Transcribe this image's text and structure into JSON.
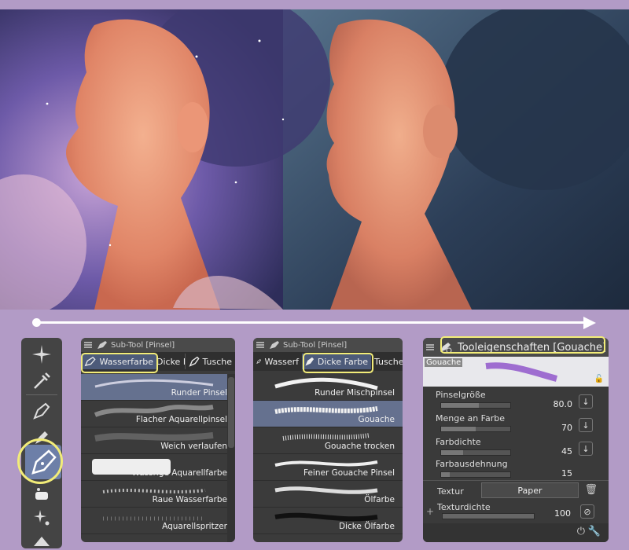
{
  "panel1": {
    "title": "Sub-Tool [Pinsel]",
    "tabs": [
      "Wasserfarbe",
      "Dicke F",
      "Tusche"
    ],
    "brushes": [
      "Runder Pinsel",
      "Flacher Aquarellpinsel",
      "Weich verlaufen",
      "Wässrige Aquarellfarbe",
      "Raue Wasserfarbe",
      "Aquarellspritzer"
    ],
    "selected": "Runder Pinsel"
  },
  "panel2": {
    "title": "Sub-Tool [Pinsel]",
    "tabs": [
      "Wasserf",
      "Dicke Farbe",
      "Tusche"
    ],
    "brushes": [
      "Runder Mischpinsel",
      "Gouache",
      "Gouache trocken",
      "Feiner Gouache Pinsel",
      "Ölfarbe",
      "Dicke Ölfarbe"
    ],
    "selected": "Gouache"
  },
  "props": {
    "title": "Tooleigenschaften [Gouache]",
    "preview_label": "Gouache",
    "rows": [
      {
        "label": "Pinselgröße",
        "value": "80.0",
        "fill": 0.55
      },
      {
        "label": "Menge an Farbe",
        "value": "70",
        "fill": 0.5
      },
      {
        "label": "Farbdichte",
        "value": "45",
        "fill": 0.32
      },
      {
        "label": "Farbausdehnung",
        "value": "15",
        "fill": 0.12
      }
    ],
    "texture_label": "Textur",
    "texture_value": "Paper",
    "density_label": "Texturdichte",
    "density_value": "100",
    "density_fill": 1
  },
  "toolbar": {
    "icons": [
      "sparkle-icon",
      "eyedropper-icon",
      "pen-icon",
      "pencil-icon",
      "brush-icon",
      "eraser-icon",
      "effects-icon"
    ],
    "active": "brush-icon"
  },
  "colors": {
    "accent_highlight": "#f2ec78",
    "selected_row": "#65718f",
    "panel_bg": "#3b3b3b",
    "page_bg": "#b29bc6"
  }
}
